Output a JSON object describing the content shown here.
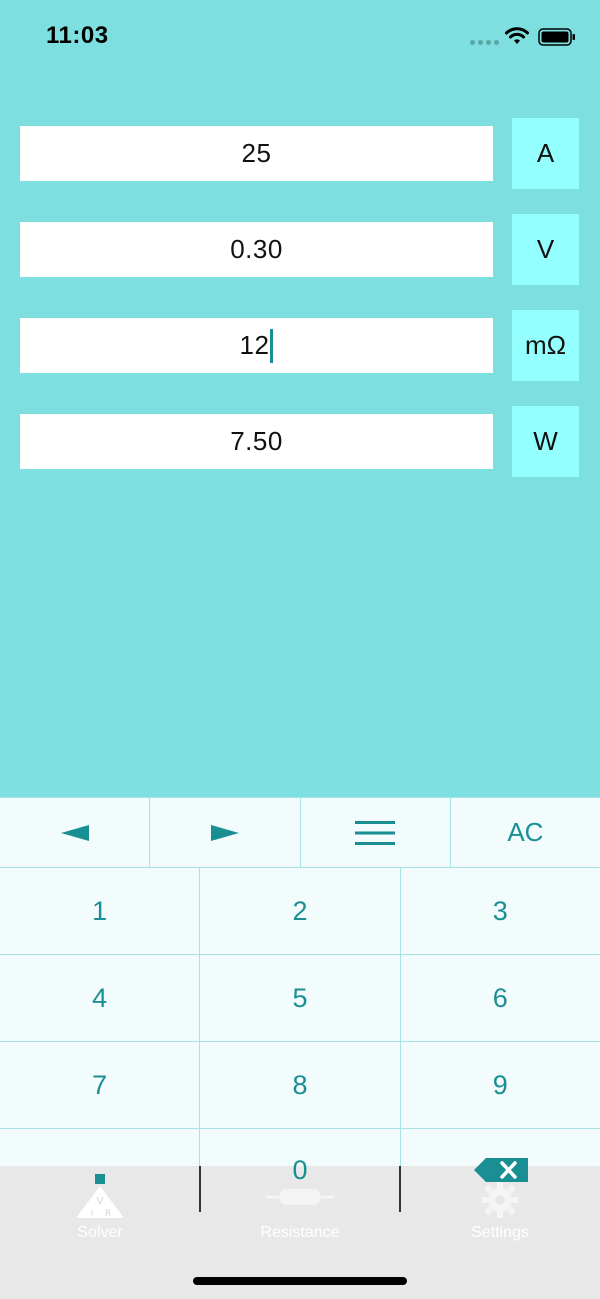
{
  "status_bar": {
    "time": "11:03"
  },
  "fields": [
    {
      "value": "25",
      "unit": "A"
    },
    {
      "value": "0.30",
      "unit": "V"
    },
    {
      "value": "12",
      "unit": "mΩ"
    },
    {
      "value": "7.50",
      "unit": "W"
    }
  ],
  "keypad": {
    "nav": {
      "left_label": "◄",
      "right_label": "►",
      "clear_label": "AC"
    },
    "digits": [
      [
        "1",
        "2",
        "3"
      ],
      [
        "4",
        "5",
        "6"
      ],
      [
        "7",
        "8",
        "9"
      ]
    ],
    "zero": "0"
  },
  "tabs": [
    {
      "label": "Solver",
      "icon": "solver-triangle-icon"
    },
    {
      "label": "Resistance",
      "icon": "resistor-icon"
    },
    {
      "label": "Settings",
      "icon": "gear-icon"
    }
  ],
  "colors": {
    "background": "#7ddfdf",
    "accent": "#1a8f93",
    "unit_bg": "#94ffff",
    "keypad_bg": "#f2fcfc"
  }
}
